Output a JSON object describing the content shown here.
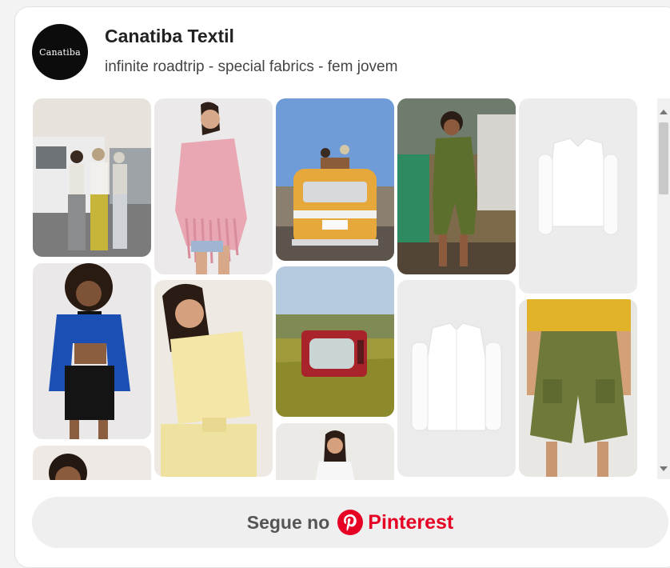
{
  "profile": {
    "avatar_text": "Canatiba",
    "name": "Canatiba Textil",
    "description": "infinite roadtrip - special fabrics - fem jovem"
  },
  "pins": [
    {
      "name": "pin-friends-van"
    },
    {
      "name": "pin-pink-fringe-jacket"
    },
    {
      "name": "pin-yellow-van"
    },
    {
      "name": "pin-green-jumpsuit"
    },
    {
      "name": "pin-white-jacket"
    },
    {
      "name": "pin-blue-corduroy-jacket"
    },
    {
      "name": "pin-yellow-denim-set"
    },
    {
      "name": "pin-tv-in-field"
    },
    {
      "name": "pin-white-shirt"
    },
    {
      "name": "pin-green-cargo-shorts"
    },
    {
      "name": "pin-partial-portrait"
    },
    {
      "name": "pin-partial-white-shirt-model"
    }
  ],
  "follow_button": {
    "prefix": "Segue no",
    "brand": "Pinterest"
  },
  "colors": {
    "pinterest_red": "#e60023",
    "button_bg": "#efefef"
  }
}
